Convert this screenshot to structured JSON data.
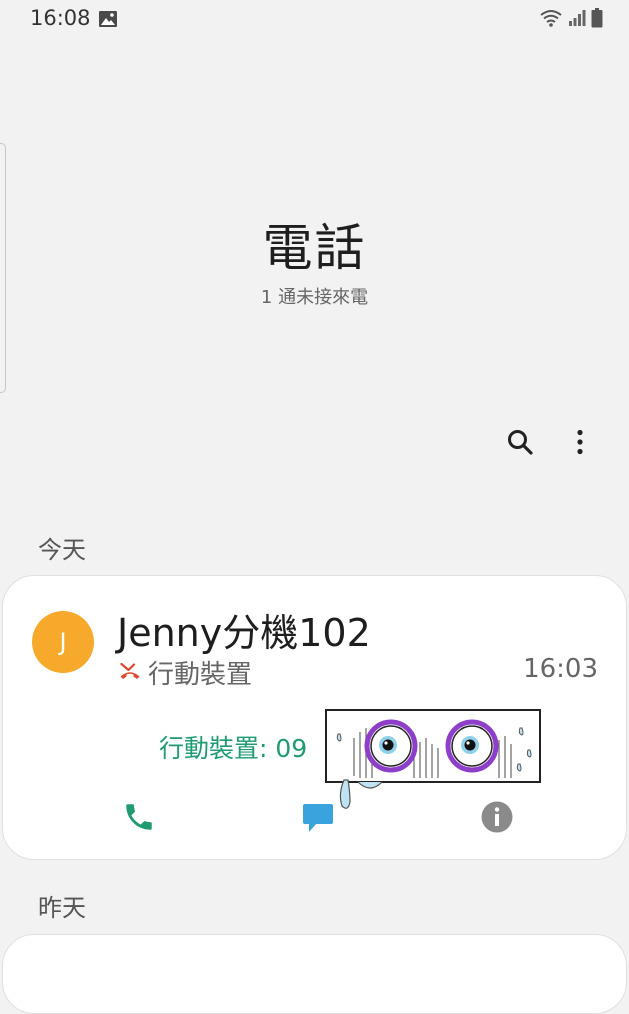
{
  "status_bar": {
    "time": "16:08",
    "icons": [
      "gallery-icon",
      "wifi-icon",
      "signal-icon",
      "battery-icon"
    ]
  },
  "header": {
    "title": "電話",
    "subtitle": "1 通未接來電"
  },
  "toolbar": {
    "icons": [
      "search-icon",
      "more-options-icon"
    ]
  },
  "sections": [
    {
      "label": "今天",
      "calls": [
        {
          "avatar_letter": "J",
          "avatar_color": "#f6a92a",
          "name": "Jenny分機102",
          "status_icon": "missed-call-icon",
          "call_type": "行動裝置",
          "time": "16:03",
          "number_label": "行動裝置: 09",
          "actions": [
            "call-icon",
            "message-icon",
            "info-icon"
          ]
        }
      ]
    },
    {
      "label": "昨天",
      "calls": []
    }
  ],
  "colors": {
    "background": "#f2f2f2",
    "card": "#ffffff",
    "accent_green": "#1f9a73",
    "missed_red": "#e0452f",
    "message_blue": "#3aa2dc",
    "info_gray": "#8a8a8a"
  }
}
